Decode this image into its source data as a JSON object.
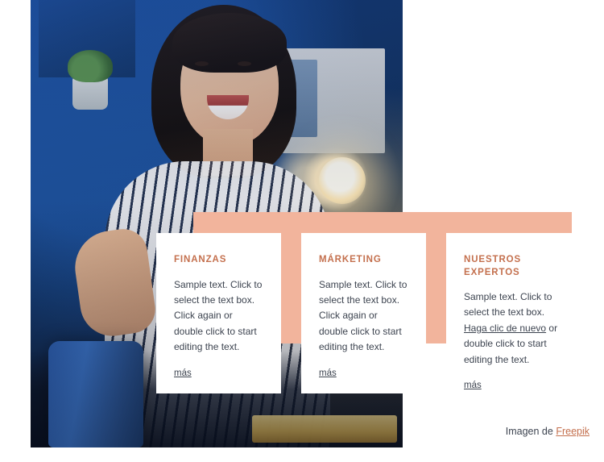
{
  "hero": {
    "alt": "Smiling woman in striped shirt at a desk in a blue-lit office at night"
  },
  "cards": [
    {
      "title": "FINANZAS",
      "paragraph": "Sample text. Click to select the text box. Click again or double click to start editing the text.",
      "more": "más"
    },
    {
      "title": "MÁRKETING",
      "paragraph": "Sample text. Click to select the text box. Click again or double click to start editing the text.",
      "more": "más"
    },
    {
      "title": "NUESTROS EXPERTOS",
      "paragraph_before": "Sample text. Click to select the text box. ",
      "link": "Haga clic de nuevo",
      "paragraph_after": " or double click to start editing the text.",
      "more": "más"
    }
  ],
  "credit": {
    "text": "Imagen de ",
    "link": "Freepik"
  },
  "colors": {
    "accent_peach": "#f2b49c",
    "title_rust": "#c4704e",
    "body_text": "#3d4450",
    "card_bg": "#ffffff",
    "page_bg": "#ffffff"
  }
}
